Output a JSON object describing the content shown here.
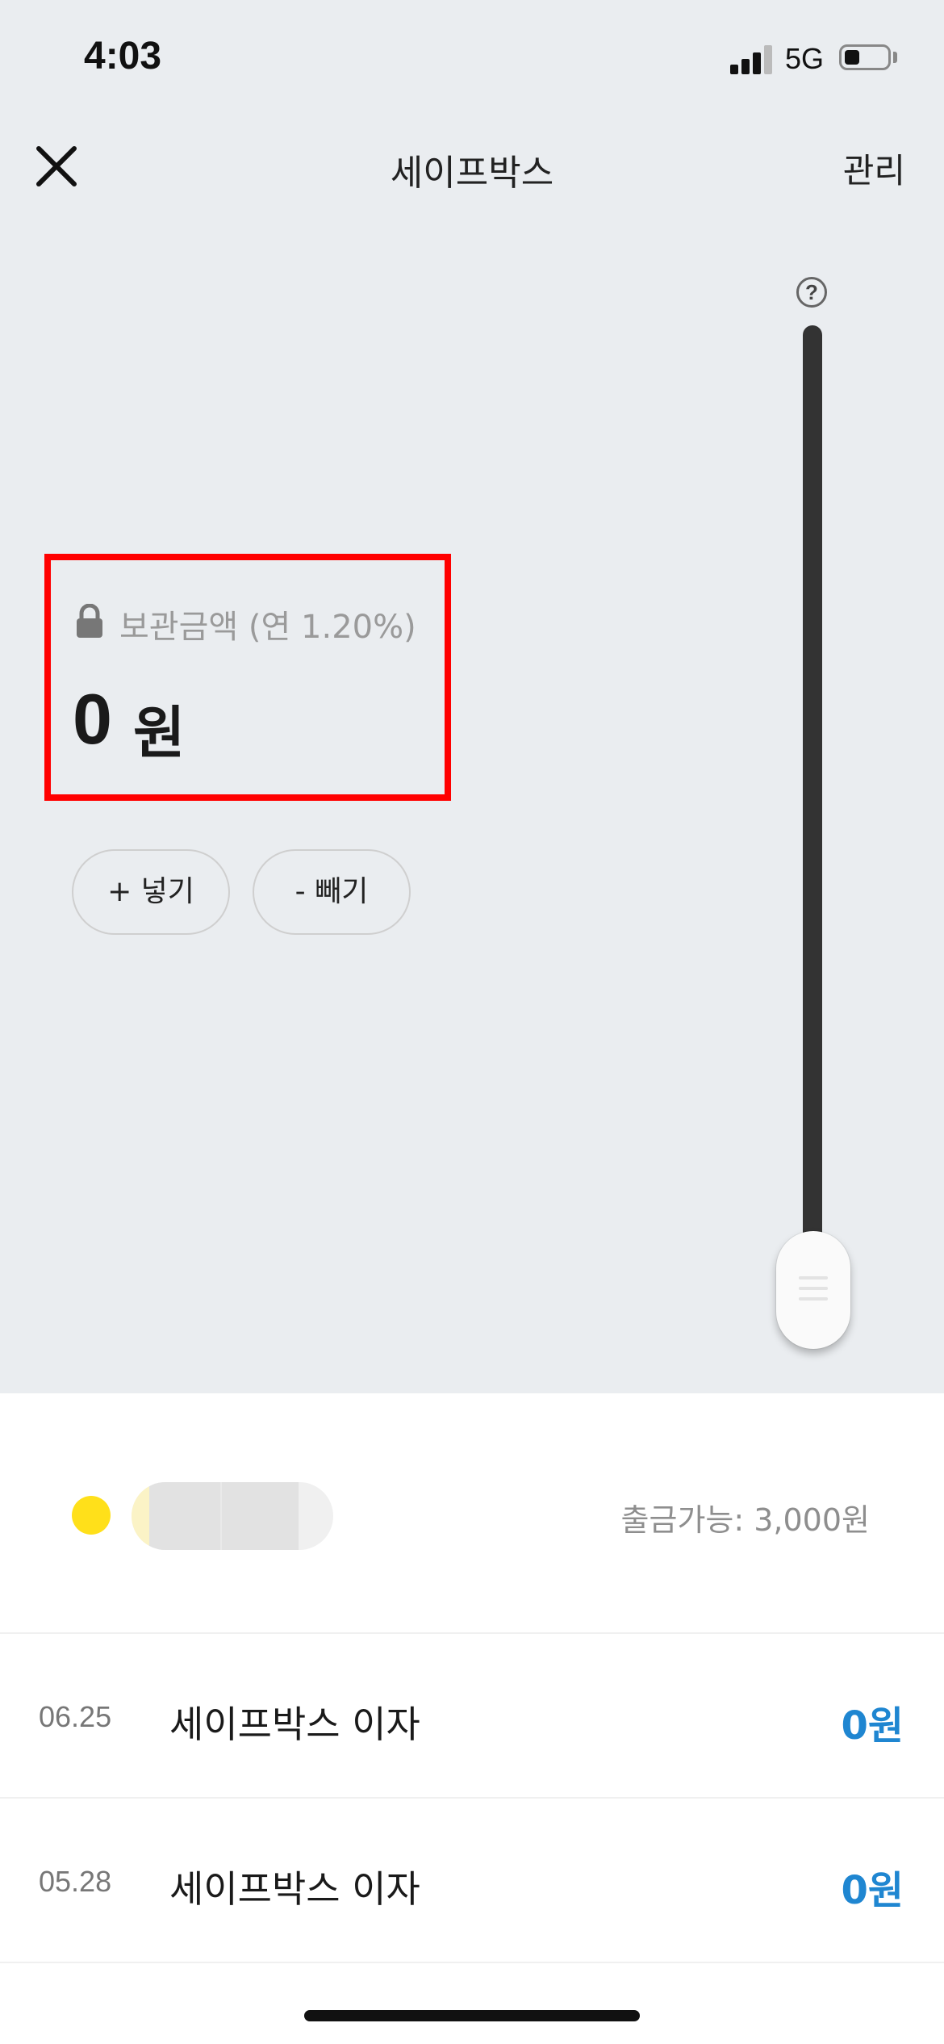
{
  "status_bar": {
    "time": "4:03",
    "network": "5G",
    "battery_level": 0.35
  },
  "nav": {
    "title": "세이프박스",
    "manage_label": "관리",
    "close_icon": "close-icon"
  },
  "safebox": {
    "help_icon_label": "?",
    "amount_label": "보관금액 (연 1.20%)",
    "amount_value": "0",
    "amount_unit": "원",
    "deposit_label": "+ 넣기",
    "withdraw_label": "- 빼기"
  },
  "account": {
    "withdrawable_text": "출금가능: 3,000원"
  },
  "transactions": [
    {
      "date": "06.25",
      "description": "세이프박스 이자",
      "amount": "0원"
    },
    {
      "date": "05.28",
      "description": "세이프박스 이자",
      "amount": "0원"
    }
  ],
  "colors": {
    "accent_blue": "#1f86d1",
    "highlight_red": "#ff0000",
    "dot_yellow": "#ffe01a",
    "background": "#eaedf0"
  }
}
